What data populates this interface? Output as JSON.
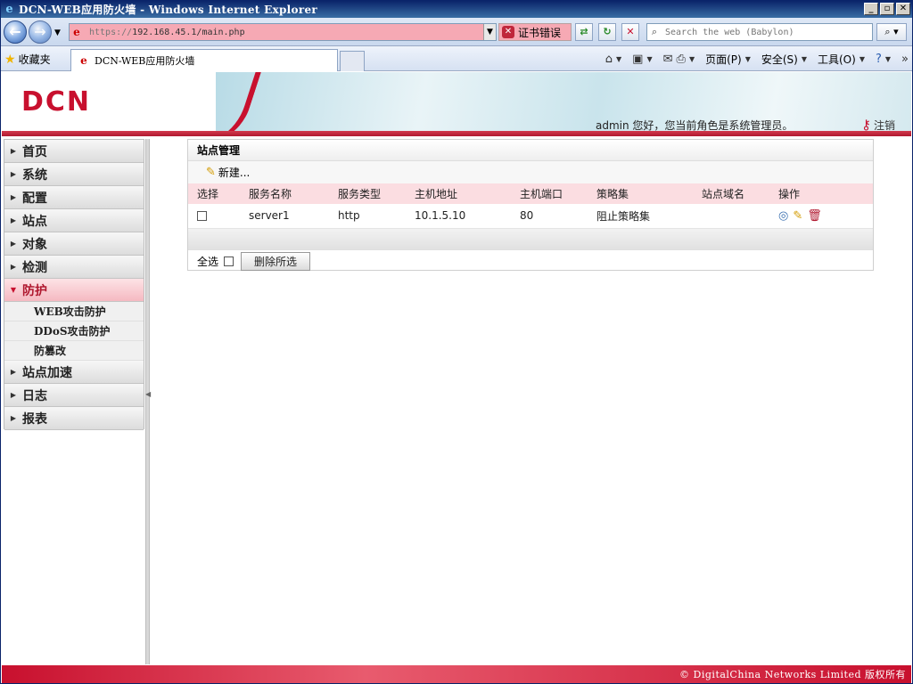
{
  "window": {
    "title": "DCN-WEB应用防火墙 - Windows Internet Explorer",
    "controls": [
      "_",
      "▫",
      "✕"
    ]
  },
  "address_bar": {
    "url_scheme": "https://",
    "url_rest": "192.168.45.1/main.php",
    "cert_error": "证书错误",
    "search_placeholder": "Search the web (Babylon)"
  },
  "favorites": {
    "label": "收藏夹",
    "tab_title": "DCN-WEB应用防火墙"
  },
  "commandbar": {
    "page": "页面(P)",
    "safety": "安全(S)",
    "tools": "工具(O)"
  },
  "header": {
    "logo": "DCN",
    "welcome": "admin 您好，您当前角色是系统管理员。",
    "logout": "注销"
  },
  "sidebar": {
    "items": [
      {
        "label": "首页"
      },
      {
        "label": "系统"
      },
      {
        "label": "配置"
      },
      {
        "label": "站点"
      },
      {
        "label": "对象"
      },
      {
        "label": "检测"
      },
      {
        "label": "防护"
      },
      {
        "label": "站点加速"
      },
      {
        "label": "日志"
      },
      {
        "label": "报表"
      }
    ],
    "sub_items": [
      {
        "label_a": "WEB",
        "label_b": " 攻击防护"
      },
      {
        "label_a": "DDoS",
        "label_b": "攻击防护"
      },
      {
        "label_a": "",
        "label_b": "防篡改"
      }
    ]
  },
  "panel": {
    "title": "站点管理",
    "new_label": "新建...",
    "columns": [
      "选择",
      "服务名称",
      "服务类型",
      "主机地址",
      "主机端口",
      "策略集",
      "站点域名",
      "操作"
    ],
    "rows": [
      {
        "service_name": "server1",
        "service_type": "http",
        "host": "10.1.5.10",
        "port": "80",
        "policy": "阻止策略集",
        "domain": ""
      }
    ],
    "select_all": "全选",
    "delete_selected": "删除所选"
  },
  "footer": {
    "copyright": "© DigitalChina Networks Limited 版权所有"
  },
  "colors": {
    "brand_red": "#c8102e",
    "header_row": "#fbdde1"
  }
}
